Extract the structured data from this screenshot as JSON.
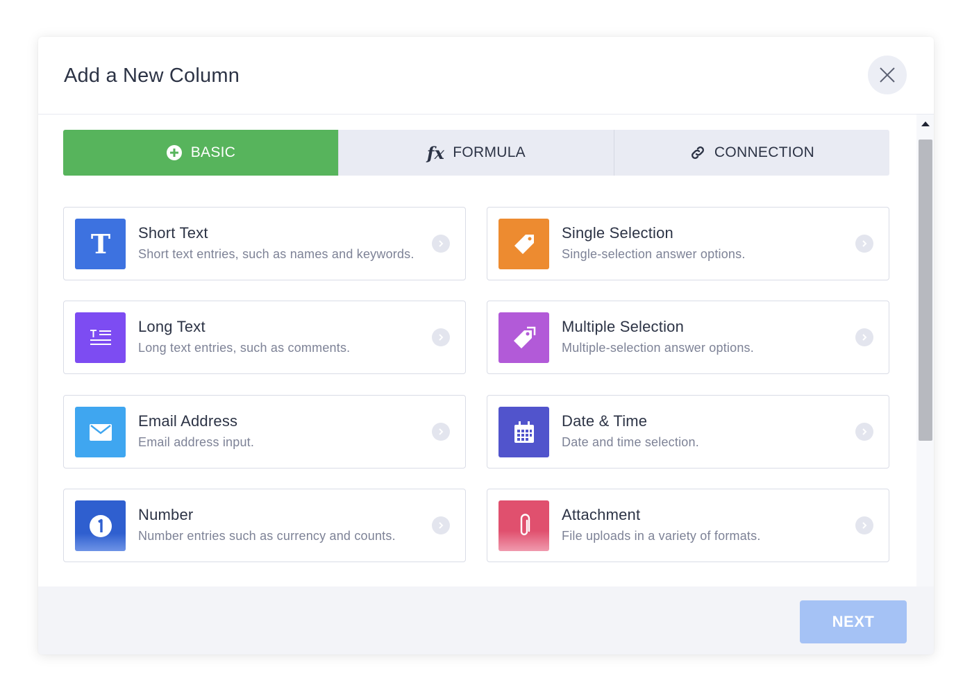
{
  "modal": {
    "title": "Add a New Column"
  },
  "tabs": [
    {
      "label": "BASIC",
      "icon": "plus-circle-icon",
      "active": true
    },
    {
      "label": "FORMULA",
      "icon": "fx-icon",
      "icon_text": "fx",
      "active": false
    },
    {
      "label": "CONNECTION",
      "icon": "link-icon",
      "active": false
    }
  ],
  "cards": [
    {
      "name": "Short Text",
      "desc": "Short text entries, such as names and keywords.",
      "icon": "letter-t-icon",
      "color": "#3d72e0"
    },
    {
      "name": "Single Selection",
      "desc": "Single-selection answer options.",
      "icon": "tag-icon",
      "color": "#ed8b30"
    },
    {
      "name": "Long Text",
      "desc": "Long text entries, such as comments.",
      "icon": "paragraph-icon",
      "color": "#7d4cf2"
    },
    {
      "name": "Multiple Selection",
      "desc": "Multiple-selection answer options.",
      "icon": "tags-icon",
      "color": "#b25ad8"
    },
    {
      "name": "Email Address",
      "desc": "Email address input.",
      "icon": "envelope-icon",
      "color": "#3fa6f0"
    },
    {
      "name": "Date & Time",
      "desc": "Date and time selection.",
      "icon": "calendar-icon",
      "color": "#5154cc"
    },
    {
      "name": "Number",
      "desc": "Number entries such as currency and counts.",
      "icon": "number-one-icon",
      "color": "#2f5fcf"
    },
    {
      "name": "Attachment",
      "desc": "File uploads in a variety of formats.",
      "icon": "paperclip-icon",
      "color": "#e0506e"
    }
  ],
  "footer": {
    "next_label": "NEXT"
  },
  "colors": {
    "active_tab": "#57b45c",
    "next_button": "#a5c2f5"
  }
}
